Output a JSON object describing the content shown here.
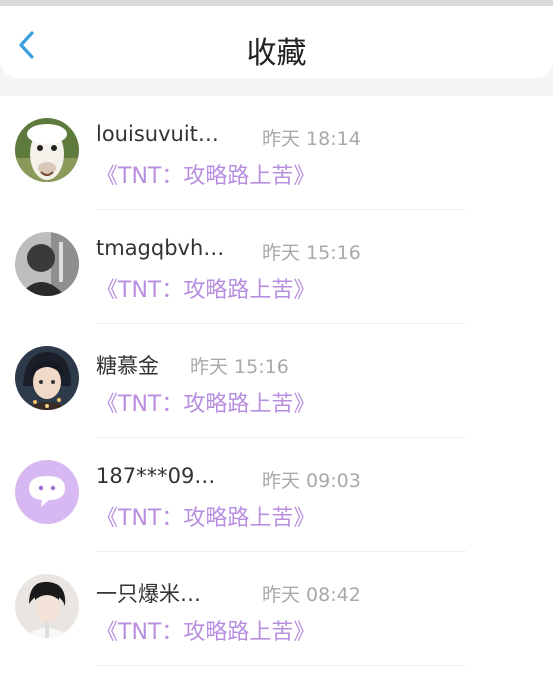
{
  "header": {
    "title": "收藏"
  },
  "items": [
    {
      "name": "louisuvuit…",
      "time": "昨天 18:14",
      "title": "《TNT：攻略路上苦》"
    },
    {
      "name": "tmagqbvh…",
      "time": "昨天 15:16",
      "title": "《TNT：攻略路上苦》"
    },
    {
      "name": "糖慕金",
      "time": "昨天 15:16",
      "title": "《TNT：攻略路上苦》"
    },
    {
      "name": "187***09…",
      "time": "昨天 09:03",
      "title": "《TNT：攻略路上苦》"
    },
    {
      "name": "一只爆米…",
      "time": "昨天 08:42",
      "title": "《TNT：攻略路上苦》"
    }
  ],
  "colors": {
    "accent": "#b88fe0",
    "back_arrow": "#3aa0e0",
    "time": "#a9a9a9"
  },
  "icons": {
    "back": "chevron-left-icon",
    "default_avatar": "chat-bubble-icon"
  }
}
